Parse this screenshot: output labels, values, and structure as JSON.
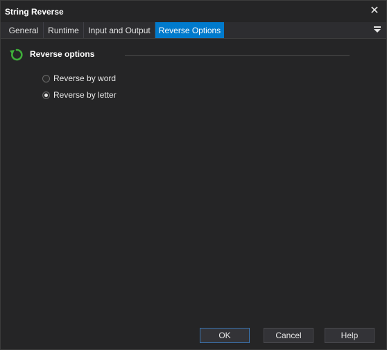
{
  "window": {
    "title": "String Reverse"
  },
  "tabs": [
    {
      "label": "General"
    },
    {
      "label": "Runtime"
    },
    {
      "label": "Input and Output"
    },
    {
      "label": "Reverse Options",
      "active": true
    }
  ],
  "section": {
    "title": "Reverse options",
    "icon": "reverse-arrow-icon"
  },
  "options": [
    {
      "label": "Reverse by word",
      "checked": false
    },
    {
      "label": "Reverse by letter",
      "checked": true
    }
  ],
  "buttons": {
    "ok": "OK",
    "cancel": "Cancel",
    "help": "Help"
  },
  "colors": {
    "accent": "#007acc",
    "background": "#252526",
    "icon_green": "#3fae3a"
  }
}
